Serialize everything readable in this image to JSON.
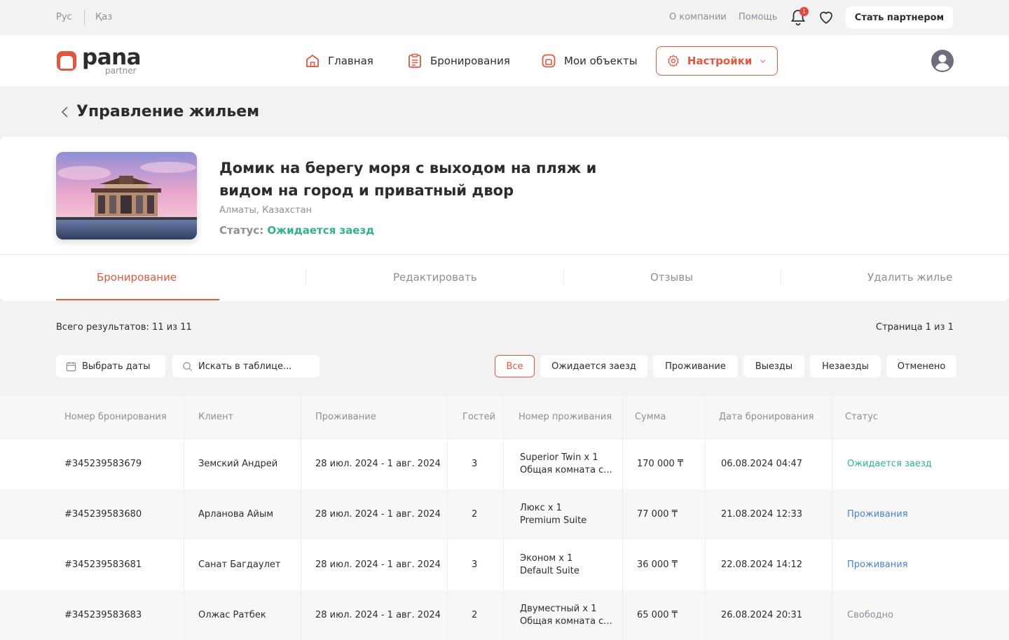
{
  "topbar": {
    "lang_ru": "Рус",
    "lang_kz": "Қаз",
    "about": "О компании",
    "help": "Помощь",
    "notif_count": "1",
    "partner_button": "Стать партнером"
  },
  "brand": {
    "name": "pana",
    "sub": "partner",
    "accent": "#e3583d"
  },
  "nav": {
    "home": "Главная",
    "bookings": "Бронирования",
    "objects": "Мои объекты",
    "settings": "Настройки"
  },
  "page": {
    "title": "Управление жильем"
  },
  "property": {
    "title": "Домик на берегу моря с выходом на пляж и видом на город и приватный двор",
    "location": "Алматы, Казахстан",
    "status_label": "Статус:",
    "status_value": "Ожидается заезд"
  },
  "tabs": [
    "Бронирование",
    "Редактировать",
    "Отзывы",
    "Удалить жилье"
  ],
  "results": {
    "total": "Всего результатов: 11 из 11",
    "page": "Страница 1 из 1"
  },
  "filters": {
    "dates": "Выбрать даты",
    "search_placeholder": "Искать в таблице..."
  },
  "chips": [
    "Все",
    "Ожидается заезд",
    "Проживание",
    "Выезды",
    "Незаезды",
    "Отменено"
  ],
  "table": {
    "headers": [
      "Номер бронирования",
      "Клиент",
      "Проживание",
      "Гостей",
      "Номер проживания",
      "Сумма",
      "Дата бронирования",
      "Статус"
    ],
    "rows": [
      {
        "id": "#345239583679",
        "client": "Земский Андрей",
        "stay": "28 июл. 2024 - 1 авг. 2024",
        "guests": "3",
        "room1": "Superior Twin x 1",
        "room2": "Общая комната с...",
        "sum": "170 000 ₸",
        "date": "06.08.2024 04:47",
        "status": "Ожидается заезд"
      },
      {
        "id": "#345239583680",
        "client": "Арланова Айым",
        "stay": "28 июл. 2024 - 1 авг. 2024",
        "guests": "2",
        "room1": "Люкс x 1",
        "room2": "Premium Suite",
        "sum": "77 000 ₸",
        "date": "21.08.2024 12:33",
        "status": "Проживания"
      },
      {
        "id": "#345239583681",
        "client": "Санат Багдаулет",
        "stay": "28 июл. 2024 - 1 авг. 2024",
        "guests": "3",
        "room1": "Эконом x 1",
        "room2": "Default Suite",
        "sum": "36 000 ₸",
        "date": "22.08.2024 14:12",
        "status": "Проживания"
      },
      {
        "id": "#345239583683",
        "client": "Олжас Ратбек",
        "stay": "28 июл. 2024 - 1 авг. 2024",
        "guests": "2",
        "room1": "Двуместный x 1",
        "room2": "Общая комната с...",
        "sum": "65 000 ₸",
        "date": "26.08.2024 20:31",
        "status": "Свободно"
      }
    ]
  }
}
